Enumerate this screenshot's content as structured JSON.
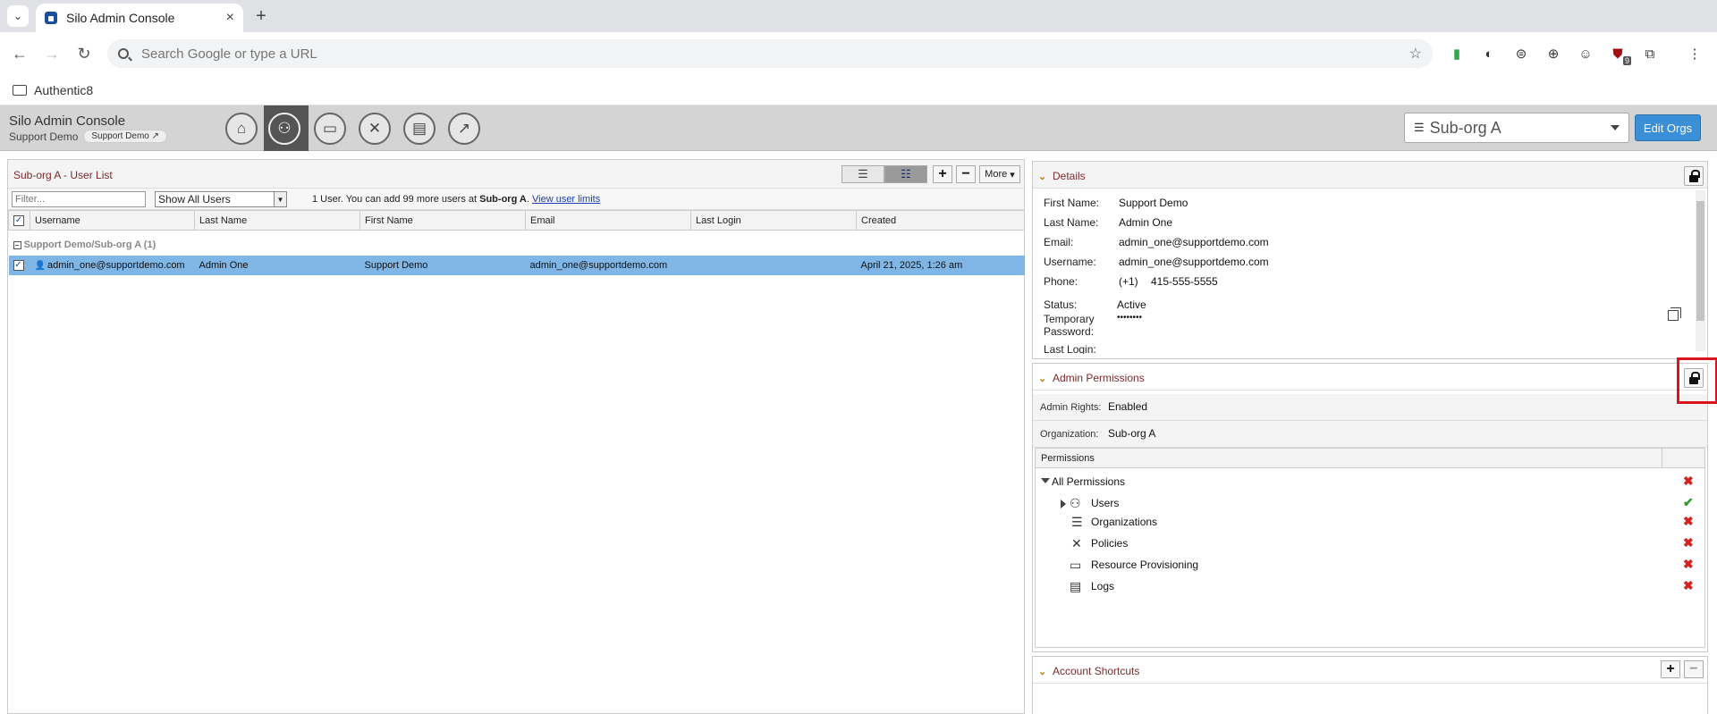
{
  "browser": {
    "tab_title": "Silo Admin Console",
    "omnibox_placeholder": "Search Google or type a URL",
    "bookmark_folder": "Authentic8",
    "ext_badge": "9"
  },
  "app": {
    "title": "Silo Admin Console",
    "subtitle": "Support Demo",
    "subtitle_pill": "Support Demo",
    "nav_icons": [
      "home-icon",
      "users-icon",
      "window-icon",
      "tools-icon",
      "logs-icon",
      "chart-icon"
    ],
    "org_selected": "Sub-org A",
    "edit_orgs_label": "Edit Orgs"
  },
  "user_list": {
    "title": "Sub-org A - User List",
    "more_label": "More",
    "filter_placeholder": "Filter...",
    "show_select": "Show All Users",
    "info_prefix": "1 User. You can add 99 more users at ",
    "info_org": "Sub-org A",
    "info_suffix": ". ",
    "info_link": "View user limits",
    "columns": [
      "Username",
      "Last Name",
      "First Name",
      "Email",
      "Last Login",
      "Created"
    ],
    "group_label": "Support Demo/Sub-org A (1)",
    "rows": [
      {
        "username": "admin_one@supportdemo.com",
        "last_name": "Admin One",
        "first_name": "Support Demo",
        "email": "admin_one@supportdemo.com",
        "last_login": "",
        "created": "April 21, 2025, 1:26 am"
      }
    ]
  },
  "details": {
    "title": "Details",
    "first_name_label": "First Name:",
    "first_name": "Support Demo",
    "last_name_label": "Last Name:",
    "last_name": "Admin One",
    "email_label": "Email:",
    "email": "admin_one@supportdemo.com",
    "username_label": "Username:",
    "username": "admin_one@supportdemo.com",
    "phone_label": "Phone:",
    "phone_cc": "(+1)",
    "phone": "415-555-5555",
    "status_label": "Status:",
    "status": "Active",
    "temp_pw_label": "Temporary Password:",
    "temp_pw": "••••••••",
    "last_login_label": "Last Login:"
  },
  "admin_permissions": {
    "title": "Admin Permissions",
    "rights_label": "Admin Rights:",
    "rights_value": "Enabled",
    "org_label": "Organization:",
    "org_value": "Sub-org A",
    "permissions_header": "Permissions",
    "items": [
      {
        "label": "All Permissions",
        "granted": false
      },
      {
        "label": "Users",
        "granted": true
      },
      {
        "label": "Organizations",
        "granted": false
      },
      {
        "label": "Policies",
        "granted": false
      },
      {
        "label": "Resource Provisioning",
        "granted": false
      },
      {
        "label": "Logs",
        "granted": false
      }
    ]
  },
  "account_shortcuts": {
    "title": "Account Shortcuts"
  },
  "colors": {
    "selected_row": "#7fb6e6",
    "accent_button": "#3a8fd6",
    "denied": "#d62020",
    "granted": "#2e9a2e",
    "highlight": "#d9141a"
  }
}
